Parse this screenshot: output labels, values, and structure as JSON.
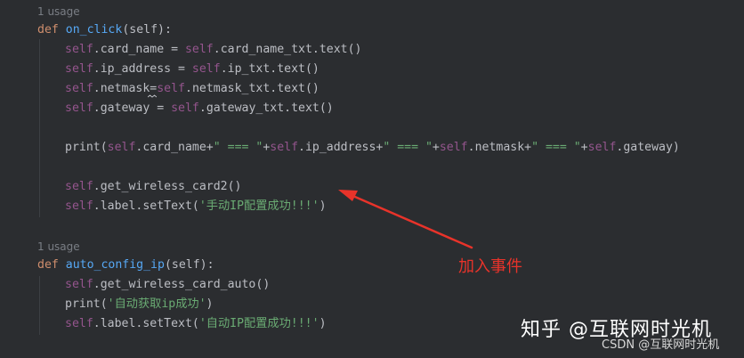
{
  "code": {
    "usage_hint_1": "1 usage",
    "def_kw": "def",
    "fn1_name": "on_click",
    "fn1_params": "(self):",
    "l3_a": "self",
    "l3_b": ".card_name = ",
    "l3_c": "self",
    "l3_d": ".card_name_txt.text()",
    "l4_a": "self",
    "l4_b": ".ip_address = ",
    "l4_c": "self",
    "l4_d": ".ip_txt.text()",
    "l5_a": "self",
    "l5_b": ".netmask=",
    "l5_c": "self",
    "l5_d": ".netmask_txt.text()",
    "l6_a": "self",
    "l6_b": ".gateway = ",
    "l6_c": "self",
    "l6_d": ".gateway_txt.text()",
    "l8_print": "print(",
    "l8_self1": "self",
    "l8_p1": ".card_name+",
    "l8_s1": "\" === \"",
    "l8_p2": "+",
    "l8_self2": "self",
    "l8_p3": ".ip_address+",
    "l8_s2": "\" === \"",
    "l8_p4": "+",
    "l8_self3": "self",
    "l8_p5": ".netmask+",
    "l8_s3": "\" === \"",
    "l8_p6": "+",
    "l8_self4": "self",
    "l8_p7": ".gateway)",
    "l10_a": "self",
    "l10_b": ".get_wireless_card2()",
    "l11_a": "self",
    "l11_b": ".label.setText(",
    "l11_str": "'手动IP配置成功!!!'",
    "l11_c": ")",
    "usage_hint_2": "1 usage",
    "fn2_name": "auto_config_ip",
    "fn2_params": "(self):",
    "l14_a": "self",
    "l14_b": ".get_wireless_card_auto()",
    "l15_print": "print(",
    "l15_str": "'自动获取ip成功'",
    "l15_c": ")",
    "l16_a": "self",
    "l16_b": ".label.setText(",
    "l16_str": "'自动IP配置成功!!!'",
    "l16_c": ")"
  },
  "annotation": {
    "text": "加入事件",
    "color": "#e8332a"
  },
  "watermark": {
    "main": "知乎 @互联网时光机",
    "sub": "CSDN @互联网时光机"
  },
  "colors": {
    "background": "#2b2d30",
    "keyword": "#cf8e6d",
    "function": "#56a8f5",
    "self": "#94558d",
    "string": "#6aab73",
    "text": "#bcbec4",
    "hint": "#7a7e85"
  }
}
